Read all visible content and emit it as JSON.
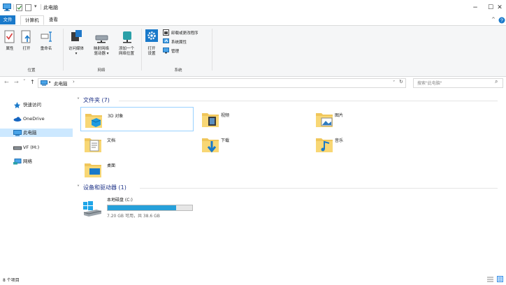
{
  "window": {
    "title": "此电脑",
    "controls": [
      "−",
      "☐",
      "✕"
    ]
  },
  "ribbon_tabs": [
    "文件",
    "计算机",
    "查看"
  ],
  "ribbon": {
    "location_group": {
      "label": "位置",
      "buttons": [
        "属性",
        "打开",
        "重命名"
      ]
    },
    "network_group": {
      "label": "网络",
      "buttons": [
        "访问媒体",
        "映射网络驱动器",
        "添加一个网络位置"
      ],
      "map_line1": "映射网络",
      "map_line2": "驱动器 ▾",
      "add_line1": "添加一个",
      "add_line2": "网络位置",
      "access_line1": "访问媒体",
      "access_line2": "▾"
    },
    "system_group": {
      "label": "系统",
      "open_settings_line1": "打开",
      "open_settings_line2": "设置",
      "uninstall": "卸载或更改程序",
      "system_properties": "系统属性",
      "manage": "管理"
    }
  },
  "address": {
    "path_root": "▸",
    "path": "此电脑",
    "path_arrow": "›",
    "search_placeholder": "搜索\"此电脑\"",
    "nav_back": "←",
    "nav_forward": "→",
    "nav_recent": "˅",
    "nav_up": "↑",
    "dropdown": "˅",
    "refresh": "↻",
    "search_icon": "⌕"
  },
  "nav_pane": [
    {
      "label": "快速访问",
      "icon": "pin-icon",
      "selected": false
    },
    {
      "label": "OneDrive",
      "icon": "cloud-icon",
      "selected": false
    },
    {
      "label": "此电脑",
      "icon": "computer-icon",
      "selected": true
    },
    {
      "label": "VF (M:)",
      "icon": "drive-icon",
      "selected": false
    },
    {
      "label": "网络",
      "icon": "network-icon",
      "selected": false
    }
  ],
  "folders_group": {
    "header": "文件夹 (7)",
    "items": [
      "3D 对象",
      "视频",
      "图片",
      "文档",
      "下载",
      "音乐",
      "桌面"
    ]
  },
  "devices_group": {
    "header": "设备和驱动器 (1)",
    "drive": {
      "name": "本地磁盘 (C:)",
      "free_text": "7.20 GB 可用，共 38.6 GB",
      "used_fraction": 0.81
    }
  },
  "status": {
    "count": "8 个项目"
  },
  "colors": {
    "accent": "#1979ca",
    "selection": "#cce8ff",
    "drive_bar": "#26a0da",
    "header_text": "#1e3287"
  }
}
